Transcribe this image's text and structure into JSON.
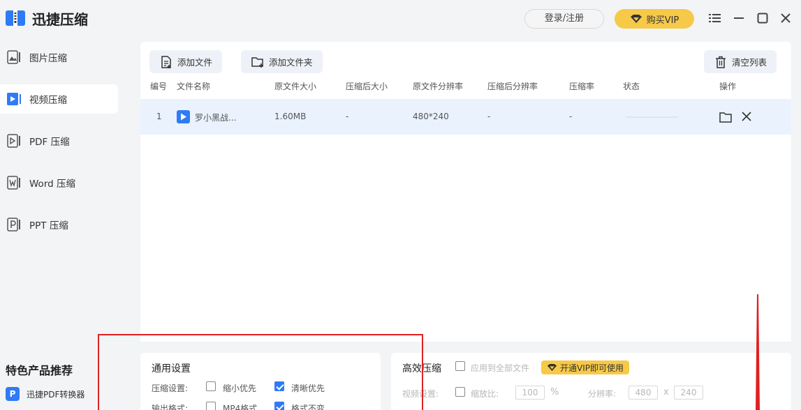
{
  "app": {
    "title": "迅捷压缩"
  },
  "header": {
    "login_label": "登录/注册",
    "vip_label": "购买VIP"
  },
  "sidebar": {
    "items": [
      {
        "label": "图片压缩"
      },
      {
        "label": "视频压缩"
      },
      {
        "label": "PDF 压缩"
      },
      {
        "label": "Word 压缩"
      },
      {
        "label": "PPT 压缩"
      }
    ],
    "active_index": 1,
    "promo_title": "特色产品推荐",
    "promo_item": "迅捷PDF转换器"
  },
  "toolbar": {
    "add_file": "添加文件",
    "add_folder": "添加文件夹",
    "clear_list": "清空列表"
  },
  "table": {
    "columns": [
      "编号",
      "文件名称",
      "原文件大小",
      "压缩后大小",
      "原文件分辨率",
      "压缩后分辨率",
      "压缩率",
      "状态",
      "操作"
    ],
    "rows": [
      {
        "index": "1",
        "name": "罗小黑战...",
        "orig_size": "1.60MB",
        "comp_size": "-",
        "orig_res": "480*240",
        "comp_res": "-",
        "ratio": "-",
        "status": ""
      }
    ]
  },
  "general_settings": {
    "title": "通用设置",
    "compress_label": "压缩设置:",
    "opt_smaller": "缩小优先",
    "opt_clear": "清晰优先",
    "smaller_checked": false,
    "clear_checked": true,
    "output_label": "输出格式:",
    "opt_mp4": "MP4格式",
    "opt_keep": "格式不变",
    "mp4_checked": false,
    "keep_checked": true
  },
  "efficient": {
    "title": "高效压缩",
    "apply_all": "应用到全部文件",
    "vip_tag": "开通VIP即可使用",
    "video_label": "视频设置:",
    "scale_label": "缩放比:",
    "scale_value": "100",
    "percent": "%",
    "res_label": "分辨率:",
    "res_w": "480",
    "times": "x",
    "res_h": "240"
  },
  "colors": {
    "accent": "#2f7bf5",
    "vip": "#f7c948",
    "annotation": "#e02020"
  }
}
